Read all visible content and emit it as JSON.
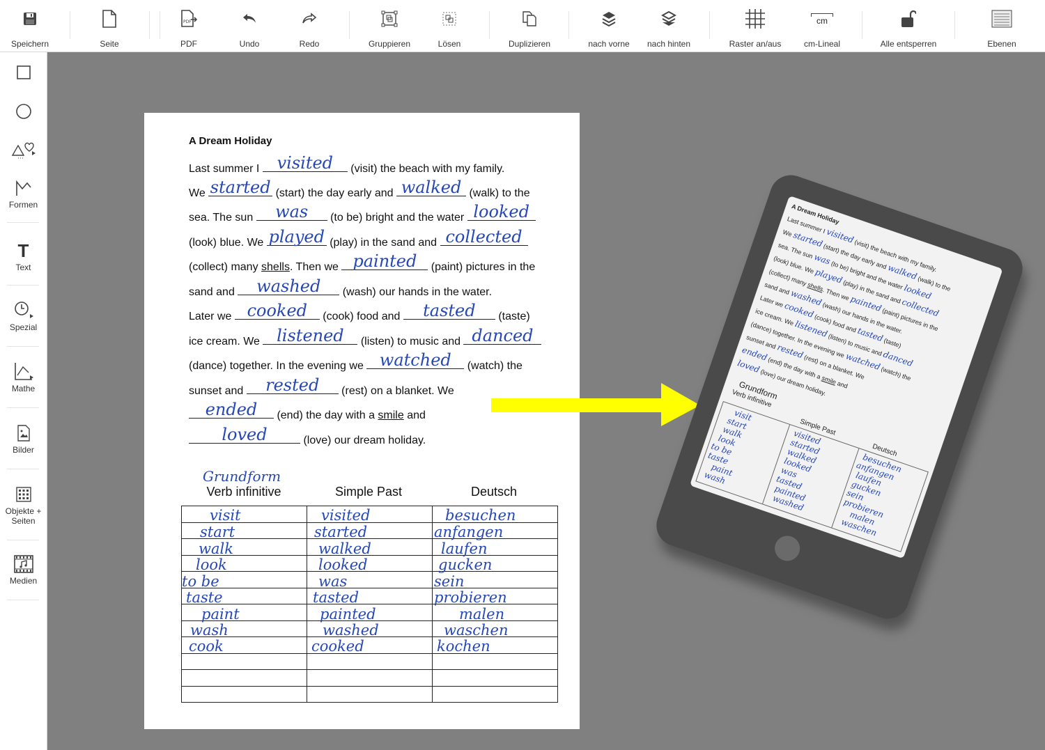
{
  "toolbar": {
    "save": "Speichern",
    "page": "Seite",
    "pdf": "PDF",
    "undo": "Undo",
    "redo": "Redo",
    "group": "Gruppieren",
    "ungroup": "Lösen",
    "duplicate": "Duplizieren",
    "bring_forward": "nach vorne",
    "send_backward": "nach hinten",
    "grid": "Raster an/aus",
    "ruler": "cm-Lineal",
    "ruler_icon_text": "cm",
    "unlock_all": "Alle entsperren",
    "layers": "Ebenen"
  },
  "sidebar": {
    "shapes": "Formen",
    "text": "Text",
    "text_icon": "T",
    "special": "Spezial",
    "math": "Mathe",
    "images": "Bilder",
    "objects": "Objekte + Seiten",
    "media": "Medien"
  },
  "worksheet": {
    "title": "A Dream Holiday",
    "l1a": "Last summer I ",
    "l1b": " (visit) the beach with my family.",
    "l2a": "We ",
    "l2b": " (start) the day early and ",
    "l2c": " (walk) to the",
    "l3a": "sea.  The sun ",
    "l3b": " (to be) bright and the water ",
    "l4a": "(look) blue. We ",
    "l4b": " (play) in the sand and ",
    "l5a": "(collect) many ",
    "l5u": "shells",
    "l5b": ". Then we ",
    "l5c": " (paint) pictures in the",
    "l6a": "sand and ",
    "l6b": " (wash) our hands in the water.",
    "l7a": "Later we ",
    "l7b": " (cook) food and ",
    "l7c": " (taste)",
    "l8a": "ice cream. We ",
    "l8b": " (listen) to music and ",
    "l9a": "(dance) together. In the evening we ",
    "l9b": " (watch) the",
    "l10a": "sunset and ",
    "l10b": " (rest) on a blanket. We",
    "l11b": " (end) the day with a ",
    "l11u": "smile",
    "l11c": " and",
    "l12b": " (love) our dream holiday.",
    "answers": {
      "visited": "visited",
      "started": "started",
      "walked": "walked",
      "was": "was",
      "looked": "looked",
      "played": "played",
      "collected": "collected",
      "painted": "painted",
      "washed": "washed",
      "cooked": "cooked",
      "tasted": "tasted",
      "listened": "listened",
      "danced": "danced",
      "watched": "watched",
      "rested": "rested",
      "ended": "ended",
      "loved": "loved"
    },
    "table": {
      "handwritten_label": "Grundform",
      "headers": [
        "Verb infinitive",
        "Simple Past",
        "Deutsch"
      ],
      "rows": [
        [
          "visit",
          "visited",
          "besuchen"
        ],
        [
          "start",
          "started",
          "anfangen"
        ],
        [
          "walk",
          "walked",
          "laufen"
        ],
        [
          "look",
          "looked",
          "gucken"
        ],
        [
          "to be",
          "was",
          "sein"
        ],
        [
          "taste",
          "tasted",
          "probieren"
        ],
        [
          "paint",
          "painted",
          "malen"
        ],
        [
          "wash",
          "washed",
          "waschen"
        ],
        [
          "cook",
          "cooked",
          "kochen"
        ]
      ]
    }
  },
  "colors": {
    "ink": "#2547b8",
    "arrow": "#ffff00",
    "canvas": "#808080",
    "tablet": "#4a4a4a"
  }
}
